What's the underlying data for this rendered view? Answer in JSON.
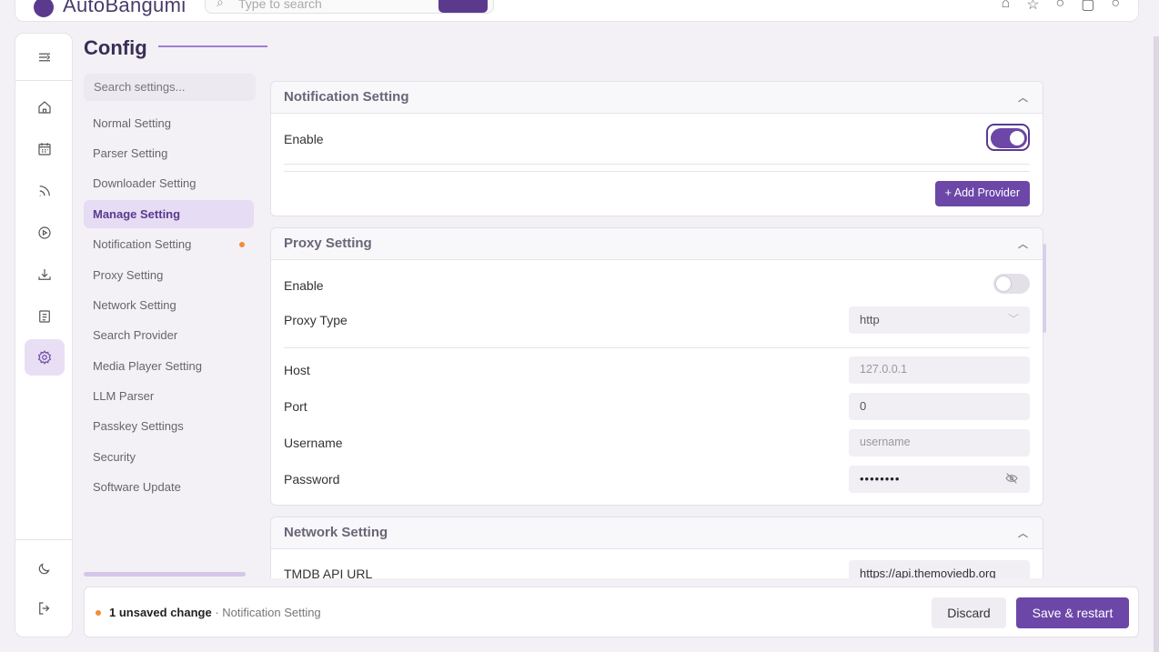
{
  "header": {
    "app_name": "AutoBangumi",
    "search_placeholder": "Type to search"
  },
  "page": {
    "title": "Config"
  },
  "nav": {
    "search_placeholder": "Search settings...",
    "items": [
      {
        "label": "Normal Setting"
      },
      {
        "label": "Parser Setting"
      },
      {
        "label": "Downloader Setting"
      },
      {
        "label": "Manage Setting",
        "active": true
      },
      {
        "label": "Notification Setting",
        "modified": true
      },
      {
        "label": "Proxy Setting"
      },
      {
        "label": "Network Setting"
      },
      {
        "label": "Search Provider"
      },
      {
        "label": "Media Player Setting"
      },
      {
        "label": "LLM Parser"
      },
      {
        "label": "Passkey Settings"
      },
      {
        "label": "Security"
      },
      {
        "label": "Software Update"
      }
    ]
  },
  "notification": {
    "title": "Notification Setting",
    "enable_label": "Enable",
    "enabled": true,
    "add_provider_label": "+ Add Provider"
  },
  "proxy": {
    "title": "Proxy Setting",
    "enable_label": "Enable",
    "enabled": false,
    "type_label": "Proxy Type",
    "type_value": "http",
    "host_label": "Host",
    "host_placeholder": "127.0.0.1",
    "port_label": "Port",
    "port_value": "0",
    "username_label": "Username",
    "username_placeholder": "username",
    "password_label": "Password",
    "password_value": "••••••••"
  },
  "network": {
    "title": "Network Setting",
    "tmdb_label": "TMDB API URL",
    "tmdb_value": "https://api.themoviedb.org"
  },
  "footer": {
    "unsaved": "1 unsaved change",
    "section": " · Notification Setting",
    "discard_label": "Discard",
    "save_label": "Save & restart"
  },
  "colors": {
    "accent": "#6c47a8",
    "accent_light": "#e6dcf4",
    "warning_dot": "#f08c3a"
  },
  "icons": {
    "rail": [
      "menu-toggle-icon",
      "home-icon",
      "calendar-icon",
      "rss-icon",
      "play-icon",
      "download-icon",
      "log-icon",
      "settings-icon",
      "moon-icon",
      "logout-icon"
    ]
  }
}
